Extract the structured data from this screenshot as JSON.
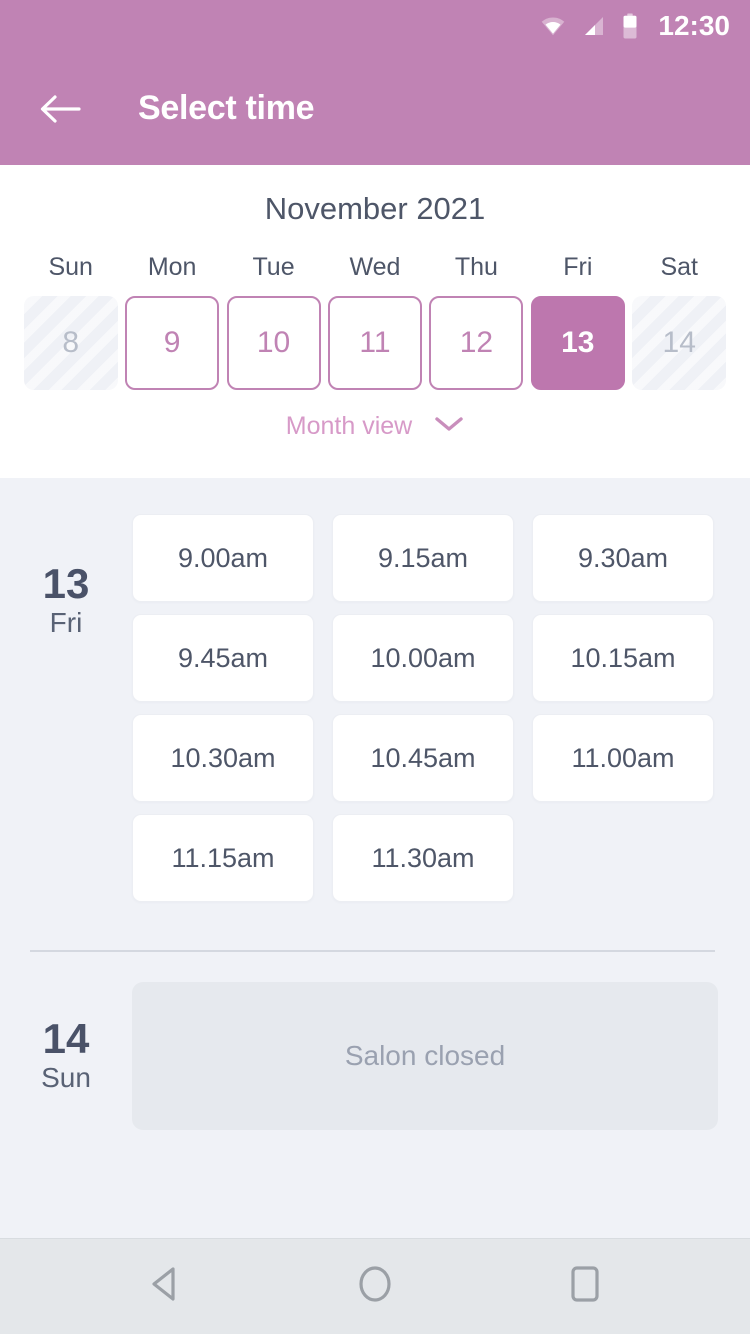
{
  "status_bar": {
    "time": "12:30",
    "wifi_icon": "wifi-icon",
    "signal_icon": "signal-icon",
    "battery_icon": "battery-icon"
  },
  "header": {
    "title": "Select time",
    "back_icon": "arrow-left-icon",
    "background_color": "#c083b4"
  },
  "calendar": {
    "month_label": "November 2021",
    "day_names": [
      "Sun",
      "Mon",
      "Tue",
      "Wed",
      "Thu",
      "Fri",
      "Sat"
    ],
    "days": [
      {
        "number": "8",
        "state": "disabled"
      },
      {
        "number": "9",
        "state": "available"
      },
      {
        "number": "10",
        "state": "available"
      },
      {
        "number": "11",
        "state": "available"
      },
      {
        "number": "12",
        "state": "available"
      },
      {
        "number": "13",
        "state": "selected"
      },
      {
        "number": "14",
        "state": "disabled"
      }
    ],
    "month_view_label": "Month view",
    "month_view_chevron_icon": "chevron-down-icon",
    "accent_color": "#c083b4",
    "selected_color": "#bd77ae"
  },
  "day_sections": [
    {
      "day_number": "13",
      "day_name": "Fri",
      "slots": [
        "9.00am",
        "9.15am",
        "9.30am",
        "9.45am",
        "10.00am",
        "10.15am",
        "10.30am",
        "10.45am",
        "11.00am",
        "11.15am",
        "11.30am"
      ]
    },
    {
      "day_number": "14",
      "day_name": "Sun",
      "closed_label": "Salon closed"
    }
  ],
  "nav_bar": {
    "back_icon": "triangle-back-icon",
    "home_icon": "circle-home-icon",
    "recents_icon": "square-recents-icon"
  }
}
